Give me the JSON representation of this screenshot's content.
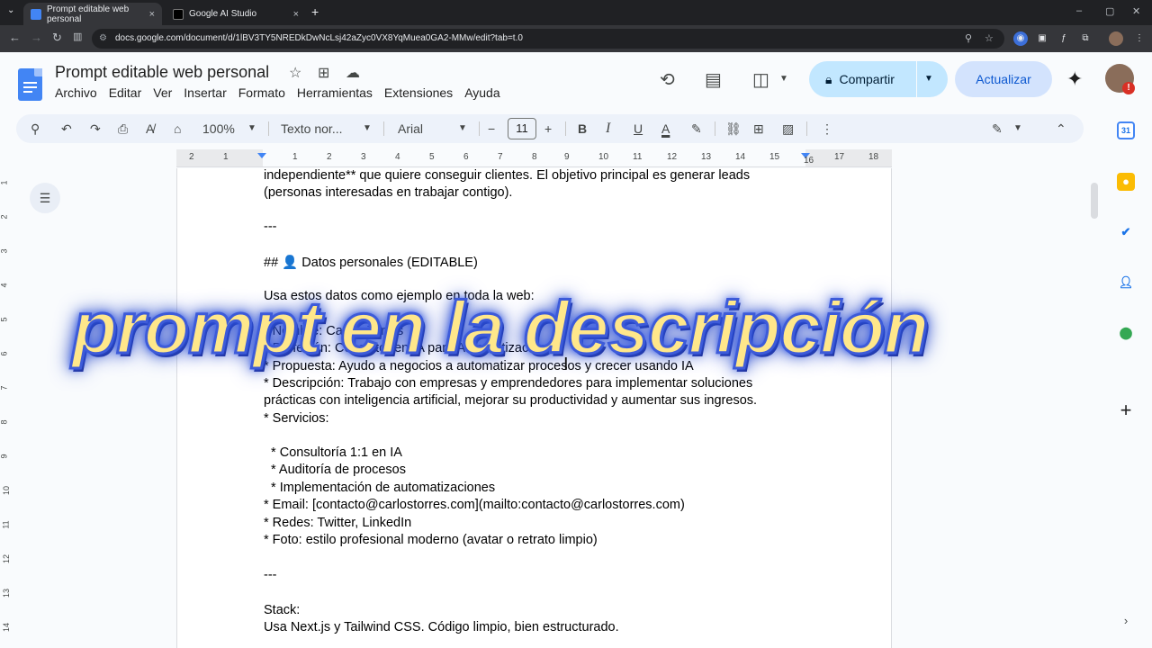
{
  "browser": {
    "tabs": [
      {
        "title": "Prompt editable web personal",
        "close": "×"
      },
      {
        "title": "Google AI Studio",
        "close": "×"
      }
    ],
    "new_tab": "+",
    "url": "docs.google.com/document/d/1lBV3TY5NREDkDwNcLsj42aZyc0VX8YqMuea0GA2-MMw/edit?tab=t.0"
  },
  "docs": {
    "title": "Prompt editable web personal",
    "menu": [
      "Archivo",
      "Editar",
      "Ver",
      "Insertar",
      "Formato",
      "Herramientas",
      "Extensiones",
      "Ayuda"
    ],
    "share_label": "Compartir",
    "update_label": "Actualizar",
    "avatar_badge": "!"
  },
  "toolbar": {
    "zoom": "100%",
    "style": "Texto nor...",
    "font": "Arial",
    "font_size": "11",
    "minus": "−",
    "plus": "+",
    "bold": "B",
    "italic": "I",
    "underline": "U",
    "text_color": "A"
  },
  "ruler": {
    "labels": [
      "2",
      "1",
      "1",
      "2",
      "3",
      "4",
      "5",
      "6",
      "7",
      "8",
      "9",
      "10",
      "11",
      "12",
      "13",
      "14",
      "15",
      "16",
      "17",
      "18"
    ]
  },
  "vruler": {
    "labels": [
      "1",
      "2",
      "3",
      "4",
      "5",
      "6",
      "7",
      "8",
      "9",
      "10",
      "11",
      "12",
      "13",
      "14"
    ]
  },
  "document": {
    "lines": [
      "independiente** que quiere conseguir clientes. El objetivo principal es generar leads",
      "(personas interesadas en trabajar contigo).",
      "---",
      "## 👤 Datos personales (EDITABLE)",
      "Usa estos datos como ejemplo en toda la web:",
      "* Nombre: Carlos Torres",
      "* Profesión: Consultor en IA para Automatización",
      "* Propuesta: Ayudo a negocios a automatizar procesos y crecer usando IA",
      "* Descripción: Trabajo con empresas y emprendedores para implementar soluciones",
      "prácticas con inteligencia artificial, mejorar su productividad y aumentar sus ingresos.",
      "* Servicios:",
      "  * Consultoría 1:1 en IA",
      "  * Auditoría de procesos",
      "  * Implementación de automatizaciones",
      "* Email: [contacto@carlostorres.com](mailto:contacto@carlostorres.com)",
      "* Redes: Twitter, LinkedIn",
      "* Foto: estilo profesional moderno (avatar o retrato limpio)",
      "---",
      "Stack:",
      "Usa Next.js y Tailwind CSS. Código limpio, bien estructurado."
    ]
  },
  "overlay_text": "prompt en la descripción",
  "side_panel": {
    "calendar_day": "31",
    "add": "+"
  },
  "colors": {
    "accent": "#0b57d0",
    "share_bg": "#c2e7ff",
    "update_bg": "#d3e3fd",
    "overlay_fill": "#ffe78a",
    "overlay_glow": "#3b63f5"
  }
}
